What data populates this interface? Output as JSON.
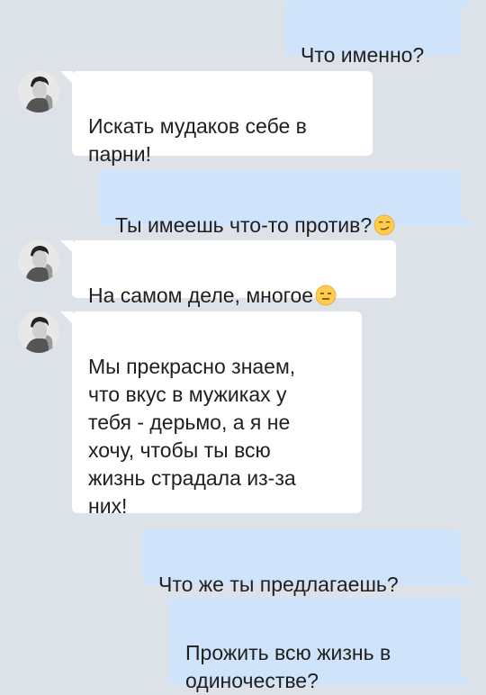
{
  "colors": {
    "background": "#dde2e9",
    "incoming_bubble": "#ffffff",
    "outgoing_bubble": "#cfe3fa",
    "text": "#1f1f1f"
  },
  "messages": [
    {
      "direction": "out",
      "text": "Что именно?"
    },
    {
      "direction": "in",
      "text": "Искать мудаков себе в\nпарни!"
    },
    {
      "direction": "out",
      "text": "Ты имеешь что-то против?",
      "emoji": "smirk-emoji"
    },
    {
      "direction": "in",
      "text": "На самом деле, многое",
      "emoji": "expressionless-emoji"
    },
    {
      "direction": "in",
      "text": "Мы прекрасно знаем,\nчто вкус в мужиках у\nтебя - дерьмо, а я не\nхочу, чтобы ты всю\nжизнь страдала из-за\nних!"
    },
    {
      "direction": "out",
      "text": "Что же ты предлагаешь?"
    },
    {
      "direction": "out",
      "text": "Прожить всю жизнь в\nодиночестве?"
    }
  ]
}
